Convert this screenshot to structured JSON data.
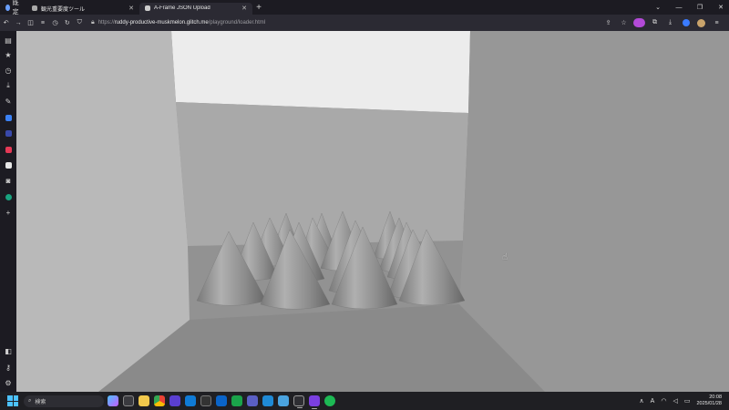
{
  "browser": {
    "workspace_label": "既定",
    "tabs": [
      {
        "title": "観光重要度ツール",
        "active": false
      },
      {
        "title": "A-Frame JSON Upload",
        "active": true
      }
    ],
    "new_tab_glyph": "+",
    "window_controls": [
      "⌄",
      "—",
      "❐",
      "✕"
    ],
    "url_prefix": "https://",
    "url_host": "ruddy-productive-muskmelon.glitch.me",
    "url_path": "/playground/loader.html"
  },
  "toolbar": {
    "buttons": [
      "back-icon",
      "forward-icon",
      "sidebar-toggle-icon",
      "tab-list-icon",
      "history-icon",
      "reload-icon",
      "shield-icon",
      "lock-icon"
    ],
    "right_buttons": [
      "share-icon",
      "bookmark-star-icon",
      "extension-purple-icon",
      "extensions-icon",
      "download-icon",
      "account-icon",
      "profile-avatar-icon"
    ]
  },
  "sidebar": {
    "items": [
      "inbox-icon",
      "star-icon",
      "history-icon",
      "download-icon",
      "pen-icon",
      "translate-icon",
      "app-icon",
      "music-icon",
      "notes-icon",
      "clip-icon",
      "chatgpt-icon",
      "add-icon"
    ],
    "bottom_items": [
      "panel-icon",
      "key-icon",
      "settings-icon"
    ]
  },
  "scene": {
    "colors": {
      "floor": "#8c8c8c",
      "back_wall": "#a9a9a9",
      "left_wall": "#b7b7b7",
      "right_wall": "#979797",
      "sky": "#ececec",
      "cone_light": "#a8a8a8",
      "cone_dark": "#6f6f6f"
    },
    "cone_count": 16
  },
  "taskbar": {
    "search_label": "検索",
    "apps": [
      "copilot-icon",
      "file-explorer-icon",
      "folder-icon",
      "chrome-icon",
      "edge-icon",
      "mail-icon",
      "terminal-icon",
      "outlook-icon",
      "teams-icon",
      "app-icon",
      "vscode-icon",
      "notepad-icon",
      "browser-icon",
      "arc-icon",
      "spotify-icon"
    ],
    "ime": "A",
    "time": "20:08",
    "date": "2025/01/28"
  }
}
